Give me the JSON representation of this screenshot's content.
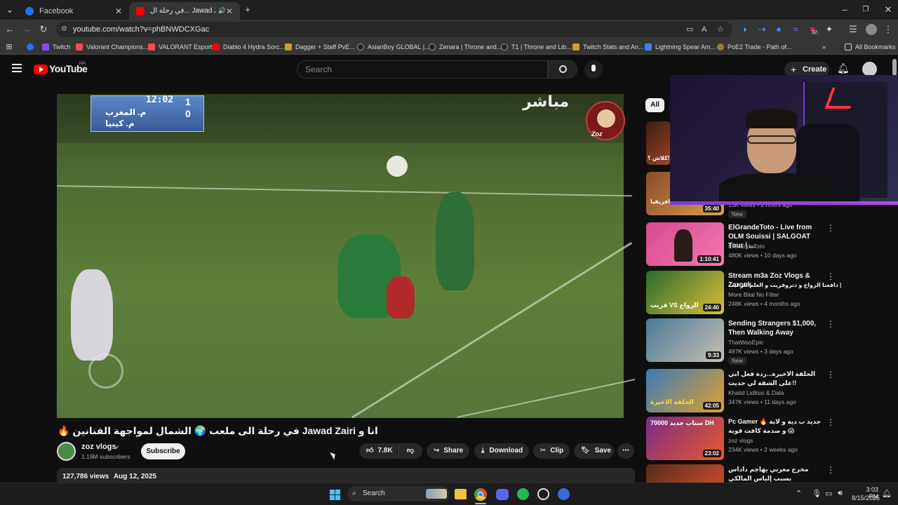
{
  "browser": {
    "tabs": [
      {
        "label": "Facebook",
        "active": false
      },
      {
        "label": "في رحلة ال... Jawad Zairi انا و",
        "active": true
      }
    ],
    "url": "youtube.com/watch?v=phBNWDCXGac",
    "bookmarks": [
      "Twitch",
      "Valorant Champions...",
      "VALORANT Esports",
      "Diablo 4 Hydra Sorc...",
      "Dagger + Staff PvE...",
      "AsianBoy GLOBAL |...",
      "Zenara | Throne and...",
      "T1 | Throne and Lib...",
      "Twitch Stats and An...",
      "Lightning Spear Am...",
      "PoE2 Trade - Path of..."
    ],
    "all_bookmarks": "All Bookmarks",
    "ext_badge": "57"
  },
  "youtube": {
    "logo": "YouTube",
    "region": "MA",
    "search_placeholder": "Search",
    "create_label": "Create",
    "filter_chip": "All"
  },
  "video": {
    "score_top": "12:02",
    "team1": "م. المغرب",
    "team2": "م. كينيا",
    "score1": "1",
    "score2": "0",
    "live_text": "مباشر",
    "watermark": "Zoz",
    "title": "🔥 في رحلة الى ملعب 🌍 الشمال لمواجهة الفنانين Jawad Zairi انا و",
    "channel": "zoz vlogs",
    "subscribers": "1.19M subscribers",
    "subscribe_label": "Subscribe",
    "likes": "7.8K",
    "share_label": "Share",
    "download_label": "Download",
    "clip_label": "Clip",
    "save_label": "Save",
    "views": "127,786 views",
    "date": "Aug 12, 2025"
  },
  "recommendations": [
    {
      "title": "",
      "channel": "",
      "stats": "",
      "duration": "",
      "thumb_text": "كلاش ؟!",
      "colors": [
        "#3a1b12",
        "#a04524"
      ]
    },
    {
      "title": "",
      "channel": "",
      "stats": "13K views • 2 hours ago",
      "duration": "35:40",
      "badge": "New",
      "thumb_text": "حلقة عاصفة في افريقيا",
      "colors": [
        "#8a4a2a",
        "#d8a04a"
      ]
    },
    {
      "title": "ElGrandeToto - Live from OLM Souissi | SALGOAT Tour | ...",
      "channel": "ElGrandeToto",
      "stats": "480K views • 10 days ago",
      "duration": "1:10:41",
      "colors": [
        "#d84a8c",
        "#f07ab0"
      ]
    },
    {
      "title": "Stream m3a Zoz Vlogs & Zarouk",
      "subtitle": "دافعنا الزواج و دتروفريت و العلم الزعيب |",
      "channel": "More Bilal No Filter",
      "stats": "248K views • 4 months ago",
      "duration": "24:40",
      "thumb_text": "فريت VS الزواج",
      "colors": [
        "#2a6a2a",
        "#d8c03a"
      ]
    },
    {
      "title": "Sending Strangers $1,000, Then Walking Away",
      "channel": "ThatWasEpic",
      "stats": "497K views • 3 days ago",
      "duration": "9:33",
      "badge": "New",
      "colors": [
        "#4a7a9a",
        "#c8c0b0"
      ]
    },
    {
      "title": "الحلقة الاخيرة...ردة فعل ابي على الشقة لي حديت!!",
      "channel": "Khalid Lidlissi & Dala",
      "stats": "347K views • 11 days ago",
      "duration": "42:05",
      "thumb_text": "الحلقة الاخيرة",
      "colors": [
        "#3a7ab8",
        "#e0a030"
      ]
    },
    {
      "title": "Pc Gamer 🔥 جديد ب دية و لابة و صدمة كافت قوية 😱",
      "channel": "zoz vlogs",
      "stats": "234K views • 2 weeks ago",
      "duration": "23:02",
      "thumb_text": "ستاب جديد 70000 DH",
      "colors": [
        "#7a2a8a",
        "#e85a2a"
      ]
    },
    {
      "title": "مخرج مغربي يهاجم داداس بسبب إلياس المالكي",
      "channel": "",
      "stats": "",
      "duration": "",
      "colors": [
        "#5a2a1a",
        "#c04a2a"
      ]
    }
  ],
  "taskbar": {
    "search_label": "Search",
    "time": "3:03 PM",
    "date": "8/15/2025"
  },
  "colors": {
    "yt_red": "#ff0000",
    "bg": "#0f0f0f",
    "chip_active": "#f1f1f1"
  }
}
